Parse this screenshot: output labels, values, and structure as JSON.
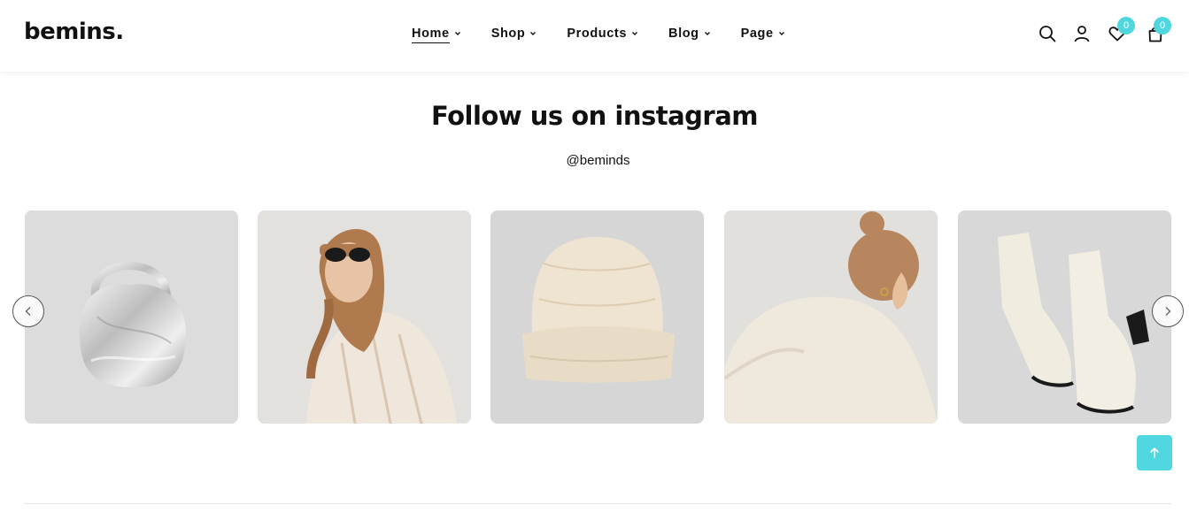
{
  "header": {
    "logo": "bemins.",
    "nav": [
      {
        "label": "Home",
        "active": true
      },
      {
        "label": "Shop",
        "active": false
      },
      {
        "label": "Products",
        "active": false
      },
      {
        "label": "Blog",
        "active": false
      },
      {
        "label": "Page",
        "active": false
      }
    ],
    "icons": [
      "search-icon",
      "user-icon",
      "heart-icon",
      "bag-icon"
    ],
    "wishlist_count": "0",
    "cart_count": "0"
  },
  "section": {
    "title": "Follow us on instagram",
    "handle": "@beminds"
  },
  "gallery": {
    "items": [
      "silver-hobo-bag",
      "woman-in-sunglasses",
      "cream-beanie",
      "woman-back-view",
      "cream-ankle-boots"
    ]
  },
  "colors": {
    "accent": "#4fd6de",
    "card_bg": "#d8d8d8"
  }
}
